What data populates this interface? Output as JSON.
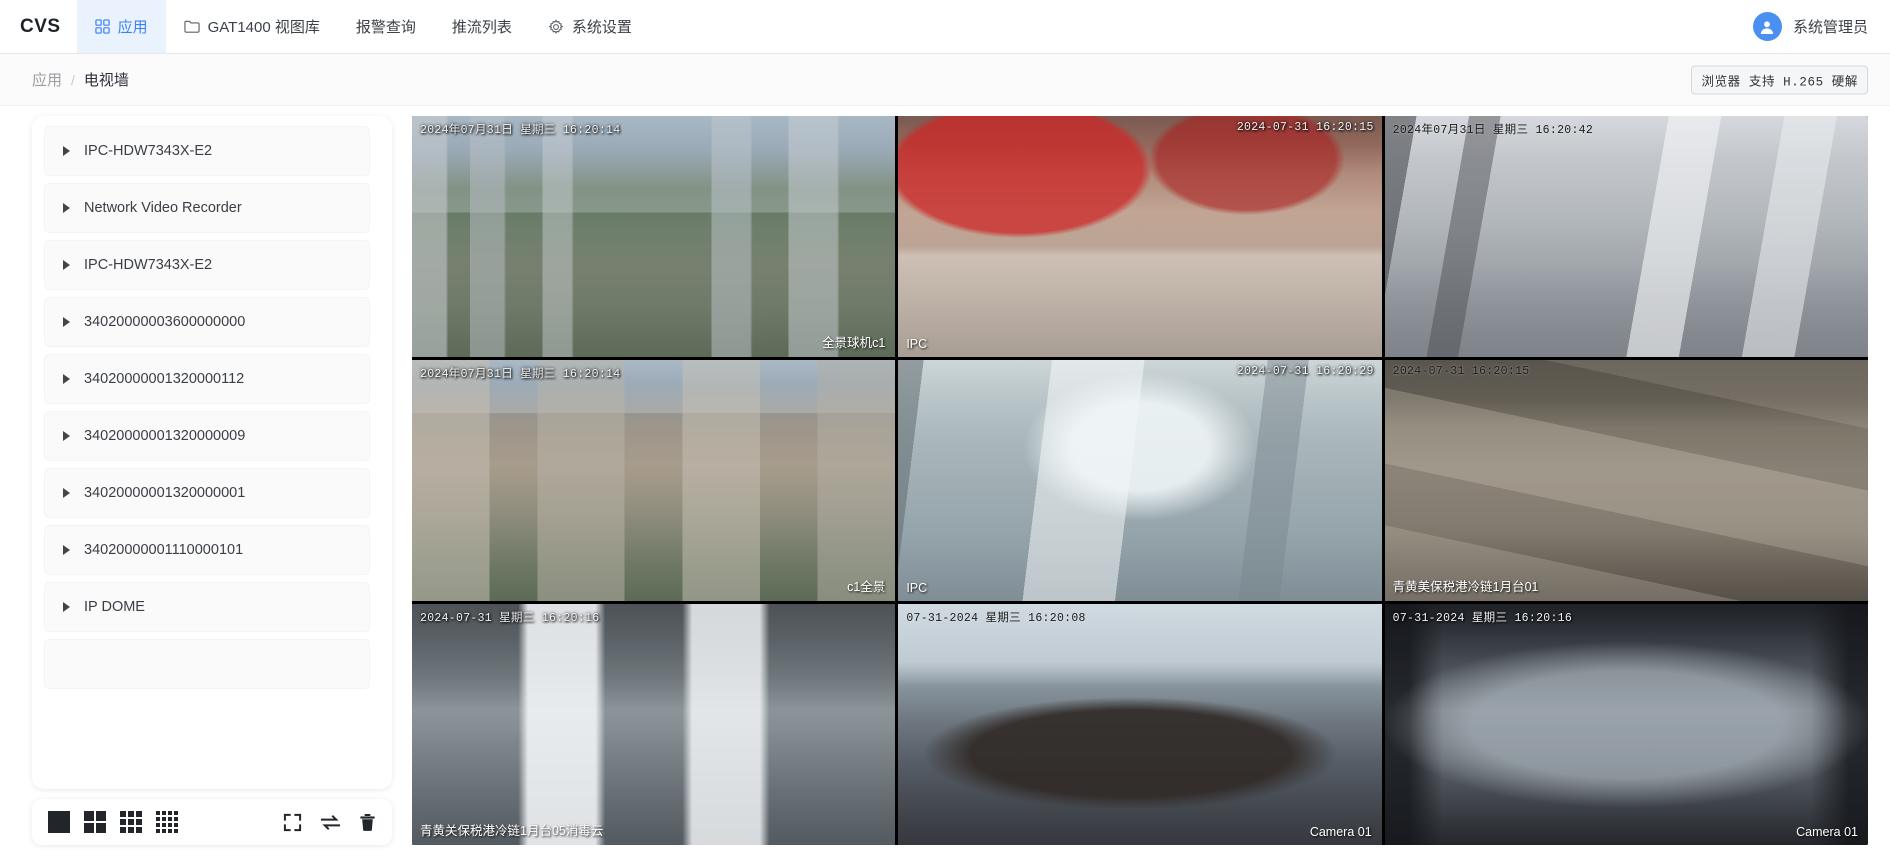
{
  "app": {
    "brand": "CVS",
    "nav": [
      {
        "label": "应用",
        "icon": "grid-apps-icon",
        "active": true
      },
      {
        "label": "GAT1400 视图库",
        "icon": "folder-icon",
        "active": false
      },
      {
        "label": "报警查询",
        "icon": "none",
        "active": false
      },
      {
        "label": "推流列表",
        "icon": "none",
        "active": false
      },
      {
        "label": "系统设置",
        "icon": "gear-icon",
        "active": false
      }
    ],
    "user": {
      "name": "系统管理员",
      "icon": "user-avatar-icon"
    }
  },
  "breadcrumb": {
    "parent": "应用",
    "separator": "/",
    "current": "电视墙"
  },
  "codec_badge": "浏览器 支持 H.265 硬解",
  "sidebar": {
    "items": [
      {
        "label": "IPC-HDW7343X-E2"
      },
      {
        "label": "Network Video Recorder"
      },
      {
        "label": "IPC-HDW7343X-E2"
      },
      {
        "label": "34020000003600000000"
      },
      {
        "label": "34020000001320000112"
      },
      {
        "label": "34020000001320000009"
      },
      {
        "label": "34020000001320000001"
      },
      {
        "label": "34020000001110000101"
      },
      {
        "label": "IP DOME"
      },
      {
        "label": ""
      }
    ]
  },
  "toolbar": {
    "layouts": [
      {
        "name": "layout-1x1",
        "cols": 1,
        "label": "1"
      },
      {
        "name": "layout-2x2",
        "cols": 2,
        "label": "4"
      },
      {
        "name": "layout-3x3",
        "cols": 3,
        "label": "9"
      },
      {
        "name": "layout-4x4",
        "cols": 4,
        "label": "16"
      }
    ],
    "actions": [
      {
        "name": "fullscreen-icon"
      },
      {
        "name": "loop-icon"
      },
      {
        "name": "trash-icon"
      }
    ]
  },
  "wall": {
    "rows": 3,
    "cols": 3,
    "tiles": [
      {
        "scene": "sc-city",
        "timestamp": "2024年07月31日 星期三 16:20:14",
        "ts_pos": "left",
        "ts_color": "light",
        "camera": "全景球机c1",
        "cam_pos": "right",
        "selected": false
      },
      {
        "scene": "sc-mall",
        "timestamp": "2024-07-31 16:20:15",
        "ts_pos": "right",
        "ts_color": "light",
        "camera": "IPC",
        "cam_pos": "left",
        "selected": false
      },
      {
        "scene": "sc-corridor",
        "timestamp": "2024年07月31日 星期三 16:20:42",
        "ts_pos": "left",
        "ts_color": "dark",
        "camera": "",
        "cam_pos": "left",
        "selected": false
      },
      {
        "scene": "sc-city2",
        "timestamp": "2024年07月31日 星期三 16:20:14",
        "ts_pos": "left",
        "ts_color": "light",
        "camera": "c1全景",
        "cam_pos": "right",
        "selected": false
      },
      {
        "scene": "sc-lobby",
        "timestamp": "2024-07-31 16:20:29",
        "ts_pos": "right",
        "ts_color": "light",
        "camera": "IPC",
        "cam_pos": "left",
        "selected": false
      },
      {
        "scene": "sc-pallet",
        "timestamp": "2024-07-31 16:20:15",
        "ts_pos": "left",
        "ts_color": "dark",
        "camera": "青黄美保税港冷链1月台01",
        "cam_pos": "left",
        "selected": false
      },
      {
        "scene": "sc-dock",
        "timestamp": "2024-07-31 星期三 16:20:16",
        "ts_pos": "left",
        "ts_color": "light",
        "camera": "青黄关保税港冷链1月台05消毒云",
        "cam_pos": "left",
        "selected": false
      },
      {
        "scene": "sc-meet",
        "timestamp": "07-31-2024 星期三 16:20:08",
        "ts_pos": "left",
        "ts_color": "dark",
        "camera": "Camera 01",
        "cam_pos": "right",
        "selected": true
      },
      {
        "scene": "sc-office",
        "timestamp": "07-31-2024 星期三 16:20:16",
        "ts_pos": "left",
        "ts_color": "light",
        "camera": "Camera 01",
        "cam_pos": "right",
        "selected": false
      }
    ]
  },
  "colors": {
    "accent": "#3b82f6",
    "nav_active_bg": "#eaf2fe",
    "avatar_bg": "#4a90f0",
    "tile_selected": "#f5c518",
    "text_primary": "#3c4048",
    "text_muted": "#9a9da3"
  }
}
